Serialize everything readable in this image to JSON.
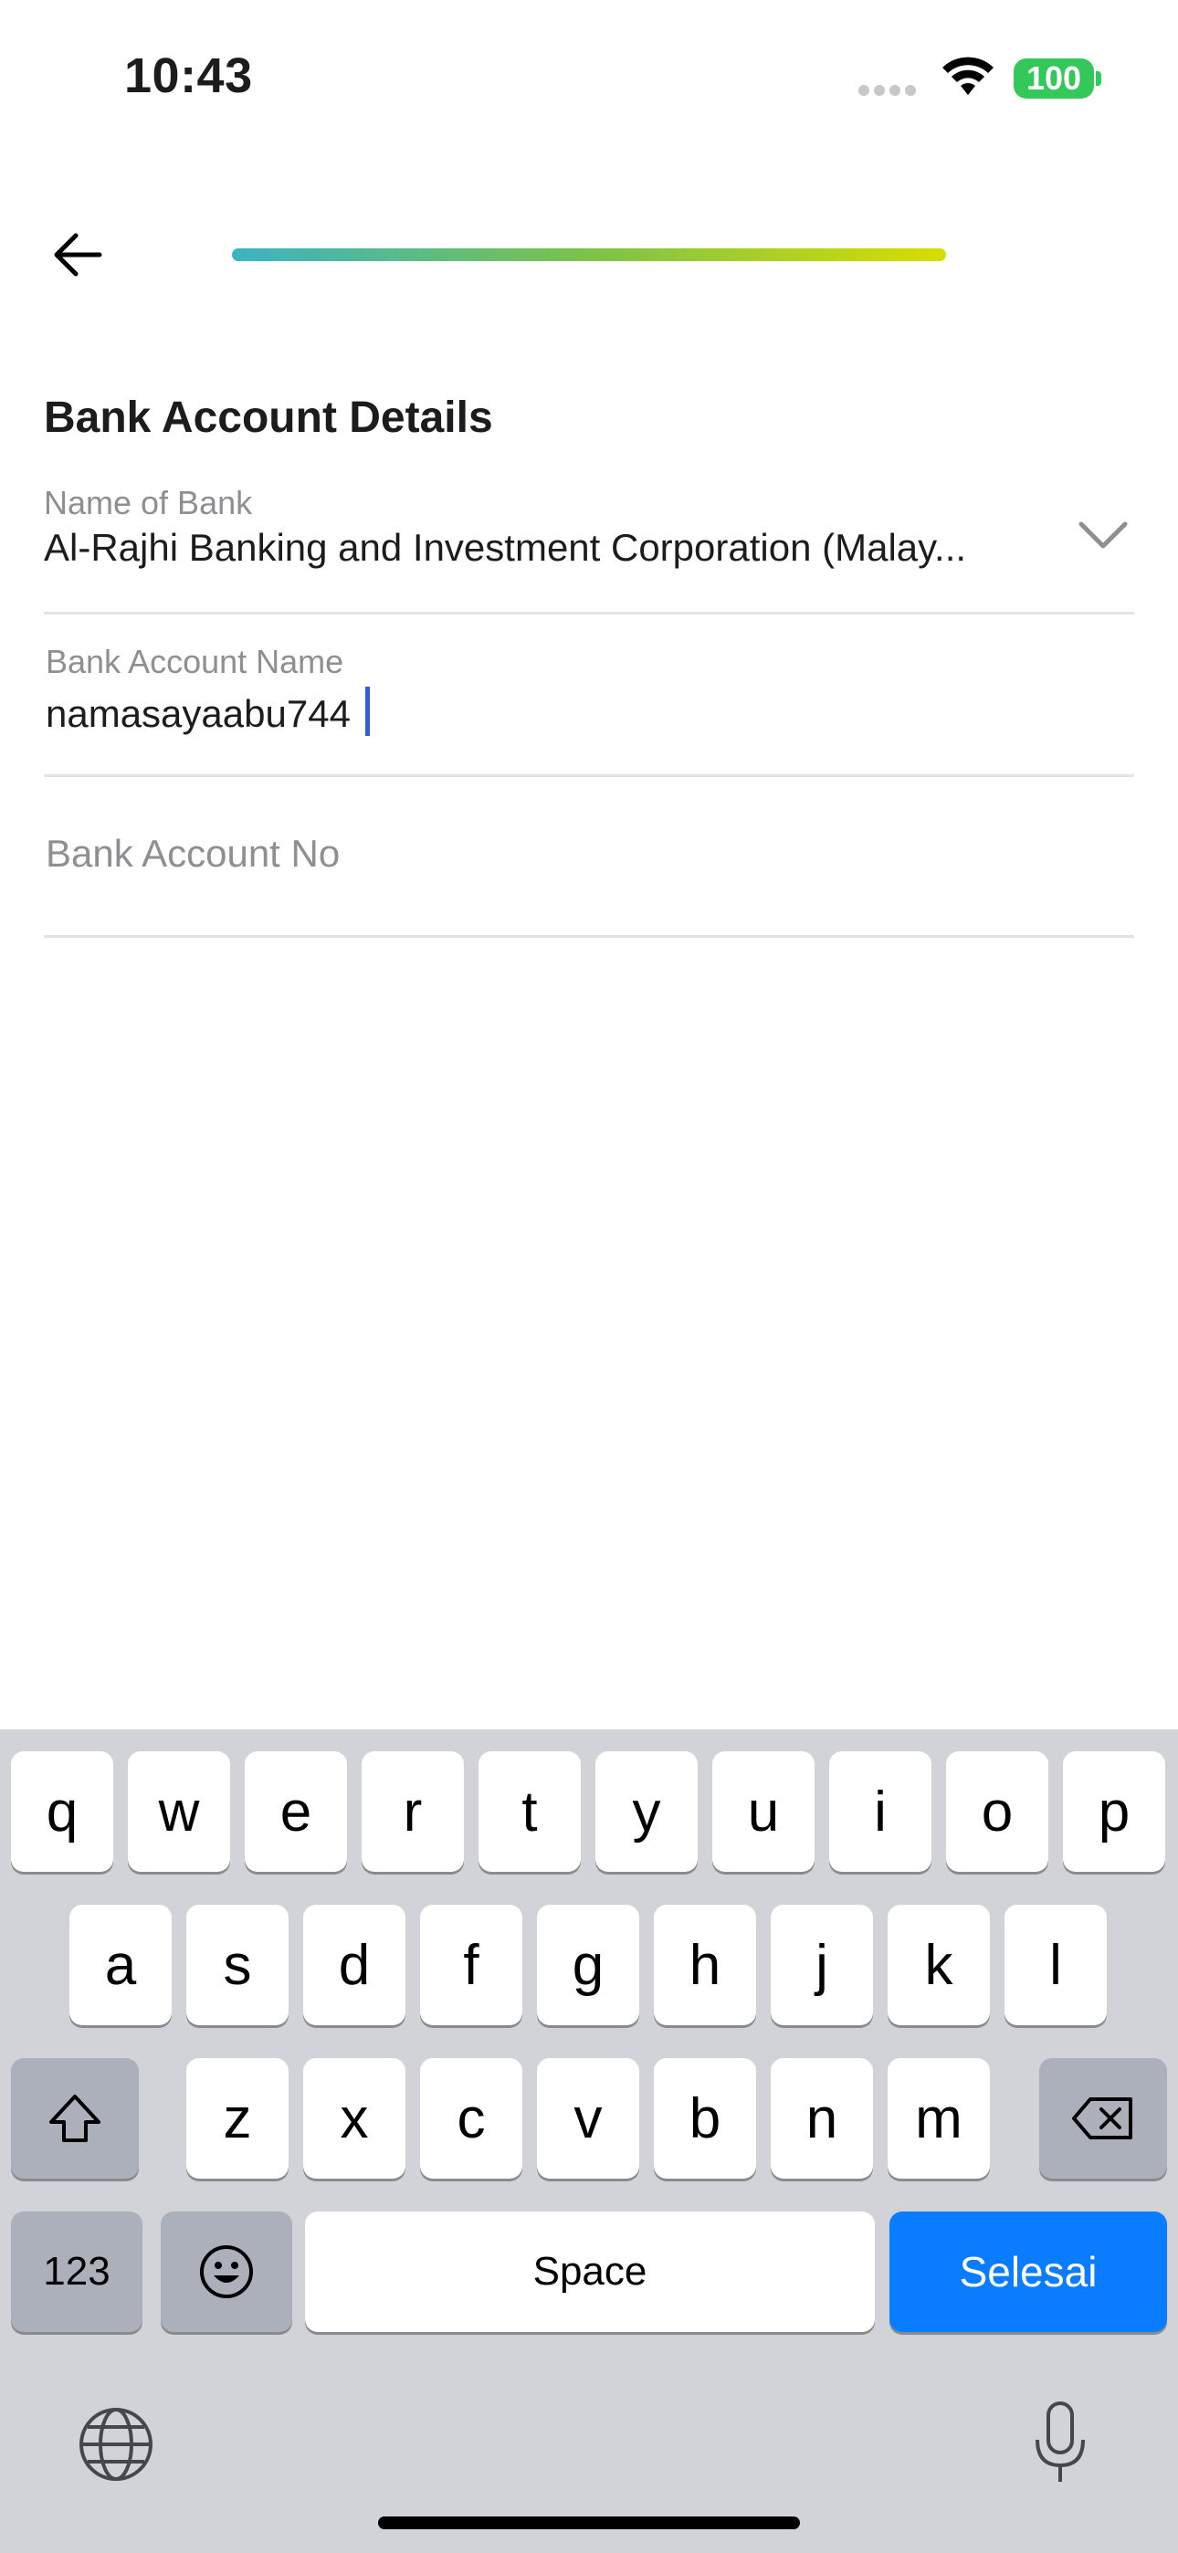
{
  "status_bar": {
    "time": "10:43",
    "battery": "100"
  },
  "form": {
    "section_title": "Bank Account Details",
    "bank": {
      "label": "Name of Bank",
      "value": "Al-Rajhi Banking and Investment Corporation (Malay..."
    },
    "account_name": {
      "label": "Bank Account Name",
      "value": "namasayaabu744"
    },
    "account_no": {
      "placeholder": "Bank Account No",
      "value": ""
    }
  },
  "keyboard": {
    "row1": [
      "q",
      "w",
      "e",
      "r",
      "t",
      "y",
      "u",
      "i",
      "o",
      "p"
    ],
    "row2": [
      "a",
      "s",
      "d",
      "f",
      "g",
      "h",
      "j",
      "k",
      "l"
    ],
    "row3": [
      "z",
      "x",
      "c",
      "v",
      "b",
      "n",
      "m"
    ],
    "numbers_label": "123",
    "space_label": "Space",
    "done_label": "Selesai"
  },
  "colors": {
    "accent_blue": "#0a7cff",
    "progress_start": "#3ab3c4",
    "progress_end": "#d8dd00",
    "battery": "#34c759"
  }
}
